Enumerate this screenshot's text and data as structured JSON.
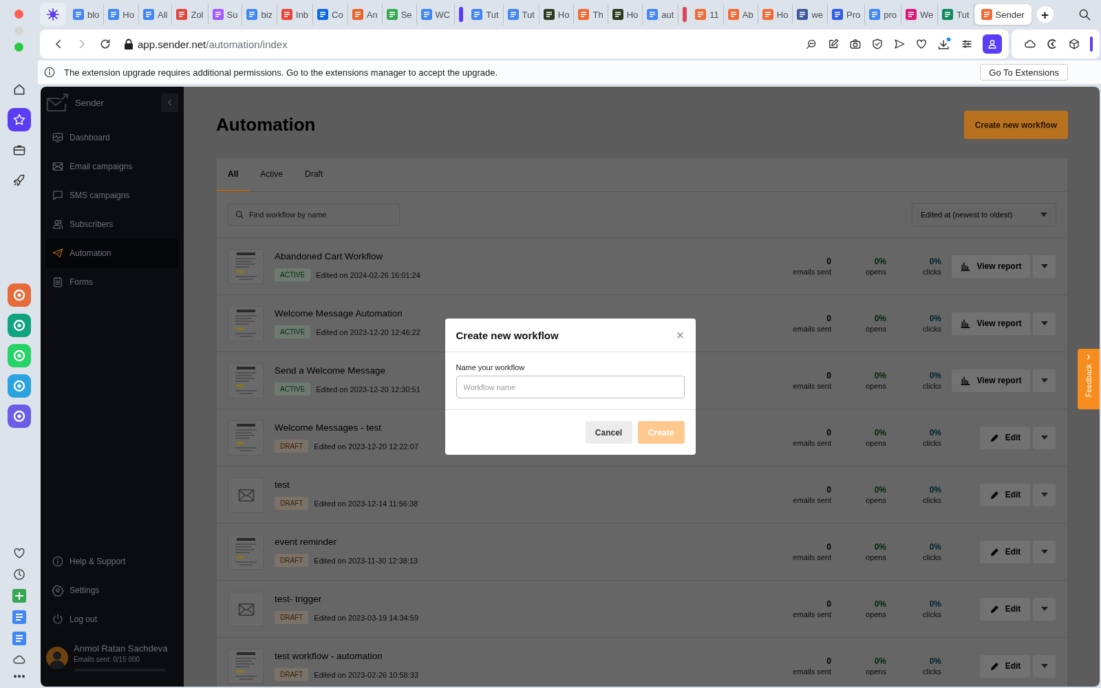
{
  "browser": {
    "tabs": [
      {
        "kind": "pinned",
        "selected": false
      },
      {
        "kind": "tab",
        "label": "blo",
        "color": "#4285f4",
        "selected": false
      },
      {
        "kind": "tab",
        "label": "Ho",
        "color": "#4285f4",
        "selected": false
      },
      {
        "kind": "tab",
        "label": "All",
        "color": "#4285f4",
        "selected": false
      },
      {
        "kind": "tab",
        "label": "Zol",
        "color": "#e0463c",
        "selected": false
      },
      {
        "kind": "tab",
        "label": "Su",
        "color": "#a259ff",
        "selected": false
      },
      {
        "kind": "tab",
        "label": "biz",
        "color": "#4285f4",
        "selected": false
      },
      {
        "kind": "tab",
        "label": "Inb",
        "color": "#ea4335",
        "selected": false
      },
      {
        "kind": "tab",
        "label": "Co",
        "color": "#0c66e4",
        "selected": false
      },
      {
        "kind": "tab",
        "label": "An",
        "color": "#e8622c",
        "selected": false
      },
      {
        "kind": "tab",
        "label": "Se",
        "color": "#34a853",
        "selected": false
      },
      {
        "kind": "tab",
        "label": "WC",
        "color": "#4285f4",
        "selected": false
      },
      {
        "kind": "group",
        "color": "#5b3df5"
      },
      {
        "kind": "tab",
        "label": "Tut",
        "color": "#4285f4",
        "selected": false
      },
      {
        "kind": "tab",
        "label": "Tut",
        "color": "#4285f4",
        "selected": false
      },
      {
        "kind": "tab",
        "label": "Ho",
        "color": "#2e3b1f",
        "selected": false
      },
      {
        "kind": "tab",
        "label": "Th",
        "color": "#f06a35",
        "selected": false
      },
      {
        "kind": "tab",
        "label": "Ho",
        "color": "#2e3b1f",
        "selected": false
      },
      {
        "kind": "tab",
        "label": "aut",
        "color": "#4285f4",
        "selected": false
      },
      {
        "kind": "group",
        "color": "#e0435a"
      },
      {
        "kind": "tab",
        "label": "11",
        "color": "#f06a35",
        "selected": false
      },
      {
        "kind": "tab",
        "label": "Ab",
        "color": "#f06a35",
        "selected": false
      },
      {
        "kind": "tab",
        "label": "Ho",
        "color": "#f06a35",
        "selected": false
      },
      {
        "kind": "tab",
        "label": "we",
        "color": "#3b5a9a",
        "selected": false
      },
      {
        "kind": "tab",
        "label": "Pro",
        "color": "#2f5bea",
        "selected": false
      },
      {
        "kind": "tab",
        "label": "pro",
        "color": "#4285f4",
        "selected": false
      },
      {
        "kind": "tab",
        "label": "We",
        "color": "#e0157a",
        "selected": false
      },
      {
        "kind": "tab",
        "label": "Tut",
        "color": "#0f8a5f",
        "selected": false
      },
      {
        "kind": "tab",
        "label": "Sender",
        "color": "#f06a35",
        "selected": true
      }
    ],
    "new_tab": "+",
    "address": {
      "host": "app.sender.net",
      "path": "/automation/index"
    },
    "infobar": {
      "message": "The extension upgrade requires additional permissions. Go to the extensions manager to accept the upgrade.",
      "button": "Go To Extensions"
    }
  },
  "dock": {
    "nav": [
      {
        "selected": false
      },
      {
        "selected": true
      },
      {
        "selected": false
      },
      {
        "selected": false
      }
    ]
  },
  "sidebar": {
    "brand": "Sender",
    "items": [
      {
        "label": "Dashboard",
        "selected": false
      },
      {
        "label": "Email campaigns",
        "selected": false
      },
      {
        "label": "SMS campaigns",
        "selected": false
      },
      {
        "label": "Subscribers",
        "selected": false
      },
      {
        "label": "Automation",
        "selected": true
      },
      {
        "label": "Forms",
        "selected": false
      }
    ],
    "footer_items": [
      "Help & Support",
      "Settings",
      "Log out"
    ],
    "user": {
      "name": "Anmol Ratan Sachdeva",
      "usage": "Emails sent: 0/15 000",
      "level": 0
    }
  },
  "page": {
    "title": "Automation",
    "create_button": "Create new workflow",
    "tabs": [
      {
        "label": "All",
        "selected": true
      },
      {
        "label": "Active",
        "selected": false
      },
      {
        "label": "Draft",
        "selected": false
      }
    ],
    "search": {
      "placeholder": "Find workflow by name"
    },
    "sort": "Edited at (newest to oldest)",
    "workflows": [
      {
        "thumbnail": {
          "kind": "template"
        },
        "name": "Abandoned Cart Workflow",
        "status": {
          "kind": "active",
          "label": "ACTIVE"
        },
        "edited": "Edited on 2024-02-26 16:01:24",
        "sent": "0",
        "sent_label": "emails sent",
        "opens": "0%",
        "opens_label": "opens",
        "clicks": "0%",
        "clicks_label": "clicks",
        "action": {
          "kind": "report",
          "label": "View report"
        }
      },
      {
        "thumbnail": {
          "kind": "template"
        },
        "name": "Welcome Message Automation",
        "status": {
          "kind": "active",
          "label": "ACTIVE"
        },
        "edited": "Edited on 2023-12-20 12:46:22",
        "sent": "0",
        "sent_label": "emails sent",
        "opens": "0%",
        "opens_label": "opens",
        "clicks": "0%",
        "clicks_label": "clicks",
        "action": {
          "kind": "report",
          "label": "View report"
        }
      },
      {
        "thumbnail": {
          "kind": "template"
        },
        "name": "Send a Welcome Message",
        "status": {
          "kind": "active",
          "label": "ACTIVE"
        },
        "edited": "Edited on 2023-12-20 12:30:51",
        "sent": "0",
        "sent_label": "emails sent",
        "opens": "0%",
        "opens_label": "opens",
        "clicks": "0%",
        "clicks_label": "clicks",
        "action": {
          "kind": "report",
          "label": "View report"
        }
      },
      {
        "thumbnail": {
          "kind": "template"
        },
        "name": "Welcome Messages - test",
        "status": {
          "kind": "draft",
          "label": "DRAFT"
        },
        "edited": "Edited on 2023-12-20 12:22:07",
        "sent": "0",
        "sent_label": "emails sent",
        "opens": "0%",
        "opens_label": "opens",
        "clicks": "0%",
        "clicks_label": "clicks",
        "action": {
          "kind": "edit",
          "label": "Edit"
        }
      },
      {
        "thumbnail": {
          "kind": "envelope"
        },
        "name": "test",
        "status": {
          "kind": "draft",
          "label": "DRAFT"
        },
        "edited": "Edited on 2023-12-14 11:56:38",
        "sent": "0",
        "sent_label": "emails sent",
        "opens": "0%",
        "opens_label": "opens",
        "clicks": "0%",
        "clicks_label": "clicks",
        "action": {
          "kind": "edit",
          "label": "Edit"
        }
      },
      {
        "thumbnail": {
          "kind": "template"
        },
        "name": "event reminder",
        "status": {
          "kind": "draft",
          "label": "DRAFT"
        },
        "edited": "Edited on 2023-11-30 12:38:13",
        "sent": "0",
        "sent_label": "emails sent",
        "opens": "0%",
        "opens_label": "opens",
        "clicks": "0%",
        "clicks_label": "clicks",
        "action": {
          "kind": "edit",
          "label": "Edit"
        }
      },
      {
        "thumbnail": {
          "kind": "envelope"
        },
        "name": "test- trigger",
        "status": {
          "kind": "draft",
          "label": "DRAFT"
        },
        "edited": "Edited on 2023-03-19 14:34:59",
        "sent": "0",
        "sent_label": "emails sent",
        "opens": "0%",
        "opens_label": "opens",
        "clicks": "0%",
        "clicks_label": "clicks",
        "action": {
          "kind": "edit",
          "label": "Edit"
        }
      },
      {
        "thumbnail": {
          "kind": "template"
        },
        "name": "test workflow - automation",
        "status": {
          "kind": "draft",
          "label": "DRAFT"
        },
        "edited": "Edited on 2023-02-26 10:58:33",
        "sent": "0",
        "sent_label": "emails sent",
        "opens": "0%",
        "opens_label": "opens",
        "clicks": "0%",
        "clicks_label": "clicks",
        "action": {
          "kind": "edit",
          "label": "Edit"
        }
      }
    ]
  },
  "modal": {
    "title": "Create new workflow",
    "close": "×",
    "field_label": "Name your workflow",
    "placeholder": "Workflow name",
    "buttons": [
      {
        "label": "Cancel",
        "kind": "secondary",
        "disabled": false
      },
      {
        "label": "Create",
        "kind": "primary",
        "disabled": true
      }
    ]
  },
  "feedback": {
    "label": "Feedback"
  }
}
